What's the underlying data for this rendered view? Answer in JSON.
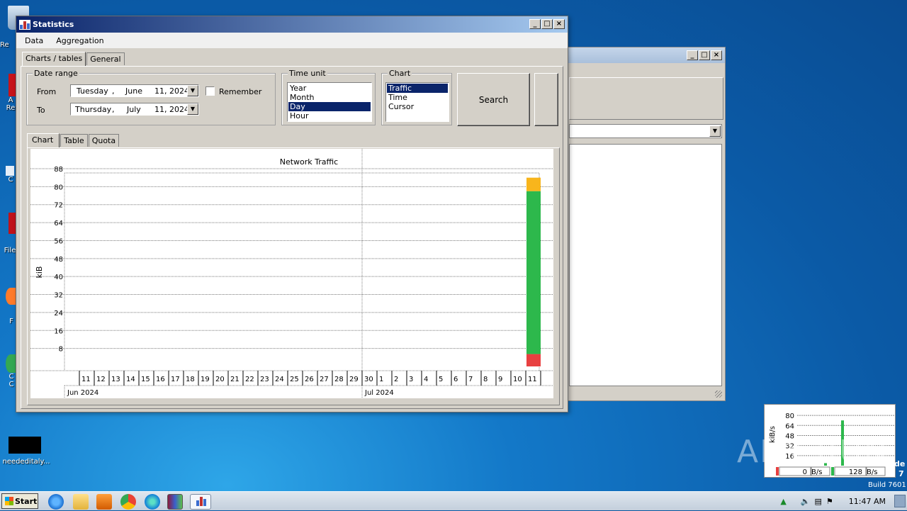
{
  "desktop": {
    "icons": [
      {
        "label": "Re"
      },
      {
        "label": "A\nRe"
      },
      {
        "label": "C"
      },
      {
        "label": "File"
      },
      {
        "label": "F"
      },
      {
        "label": "C\nC"
      },
      {
        "label": "neededitaly..."
      }
    ],
    "build_text": "Build 7601",
    "side_text_1": "de",
    "side_text_2": "7",
    "watermark": "ANY RUN"
  },
  "window": {
    "title": "Statistics",
    "menu": [
      "Data",
      "Aggregation"
    ],
    "top_tabs": [
      "Charts / tables",
      "General"
    ],
    "date_range": {
      "legend": "Date range",
      "from_label": "From",
      "to_label": "To",
      "from": {
        "weekday": "Tuesday",
        "sep": ",",
        "month": "June",
        "day_year": "11, 2024"
      },
      "to": {
        "weekday": "Thursday",
        "sep": ",",
        "month": "July",
        "day_year": "11, 2024"
      },
      "remember_label": "Remember",
      "remember_checked": false
    },
    "time_unit": {
      "legend": "Time unit",
      "options": [
        "Year",
        "Month",
        "Day",
        "Hour"
      ],
      "selected": "Day"
    },
    "chart_select": {
      "legend": "Chart",
      "options": [
        "Traffic",
        "Time",
        "Cursor"
      ],
      "selected": "Traffic"
    },
    "search_label": "Search",
    "sub_tabs": [
      "Chart",
      "Table",
      "Quota"
    ]
  },
  "chart_data": {
    "type": "bar",
    "title": "Network Traffic",
    "ylabel": "kiB",
    "xlabel": "",
    "ylim": [
      0,
      88
    ],
    "yticks": [
      8,
      16,
      24,
      32,
      40,
      48,
      56,
      64,
      72,
      80,
      88
    ],
    "categories": [
      "11",
      "12",
      "13",
      "14",
      "15",
      "16",
      "17",
      "18",
      "19",
      "20",
      "21",
      "22",
      "23",
      "24",
      "25",
      "26",
      "27",
      "28",
      "29",
      "30",
      "1",
      "2",
      "3",
      "4",
      "5",
      "6",
      "7",
      "8",
      "9",
      "10",
      "11"
    ],
    "month_labels": [
      {
        "label": "Jun 2024",
        "start_index": 0
      },
      {
        "label": "Jul 2024",
        "start_index": 20
      }
    ],
    "series": [
      {
        "color": "#e84040",
        "values": [
          0,
          0,
          0,
          0,
          0,
          0,
          0,
          0,
          0,
          0,
          0,
          0,
          0,
          0,
          0,
          0,
          0,
          0,
          0,
          0,
          0,
          0,
          0,
          0,
          0,
          0,
          0,
          0,
          0,
          0,
          5.5
        ]
      },
      {
        "color": "#2db84c",
        "values": [
          0,
          0,
          0,
          0,
          0,
          0,
          0,
          0,
          0,
          0,
          0,
          0,
          0,
          0,
          0,
          0,
          0,
          0,
          0,
          0,
          0,
          0,
          0,
          0,
          0,
          0,
          0,
          0,
          0,
          0,
          72.5
        ]
      },
      {
        "color": "#f8b51c",
        "values": [
          0,
          0,
          0,
          0,
          0,
          0,
          0,
          0,
          0,
          0,
          0,
          0,
          0,
          0,
          0,
          0,
          0,
          0,
          0,
          0,
          0,
          0,
          0,
          0,
          0,
          0,
          0,
          0,
          0,
          0,
          6
        ]
      }
    ],
    "stacked": true,
    "grid": true
  },
  "mini_chart": {
    "ylabel": "kiB/s",
    "yticks": [
      16,
      32,
      48,
      64,
      80
    ],
    "down_value": "0",
    "down_unit": "B/s",
    "up_value": "128",
    "up_unit": "B/s"
  },
  "taskbar": {
    "start_label": "Start",
    "clock": "11:47 AM"
  }
}
